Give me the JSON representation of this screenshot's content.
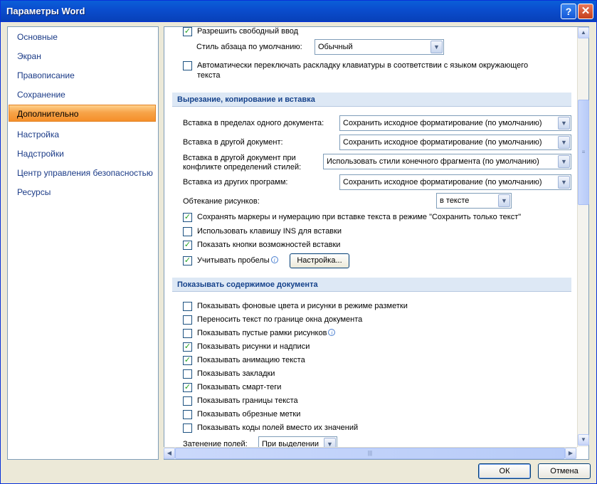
{
  "window": {
    "title": "Параметры Word",
    "help_glyph": "?",
    "close_glyph": "✕"
  },
  "sidebar": {
    "items": [
      {
        "label": "Основные"
      },
      {
        "label": "Экран"
      },
      {
        "label": "Правописание"
      },
      {
        "label": "Сохранение"
      },
      {
        "label": "Дополнительно",
        "selected": true
      },
      {
        "label": "Настройка"
      },
      {
        "label": "Надстройки"
      },
      {
        "label": "Центр управления безопасностью"
      },
      {
        "label": "Ресурсы"
      }
    ]
  },
  "editing": {
    "free_input": {
      "label": "Разрешить свободный ввод",
      "checked": true
    },
    "default_style": {
      "label": "Стиль абзаца по умолчанию:",
      "value": "Обычный"
    },
    "auto_keyboard": {
      "line1": "Автоматически переключать раскладку клавиатуры в соответствии с языком окружающего",
      "line2": "текста",
      "checked": false
    }
  },
  "cut_copy_paste": {
    "header": "Вырезание, копирование и вставка",
    "paste_same_doc": {
      "label": "Вставка в пределах одного документа:",
      "value": "Сохранить исходное форматирование (по умолчанию)"
    },
    "paste_other_doc": {
      "label": "Вставка в другой документ:",
      "value": "Сохранить исходное форматирование (по умолчанию)"
    },
    "paste_conflict": {
      "line1": "Вставка в другой документ при",
      "line2": "конфликте определений стилей:",
      "value": "Использовать стили конечного фрагмента (по умолчанию)"
    },
    "paste_other_programs": {
      "label": "Вставка из других программ:",
      "value": "Сохранить исходное форматирование (по умолчанию)"
    },
    "wrap_pictures": {
      "label": "Обтекание рисунков:",
      "value": "в тексте"
    },
    "keep_bullets": {
      "label": "Сохранять маркеры и нумерацию при вставке текста в режиме \"Сохранить только текст\"",
      "checked": true
    },
    "use_ins": {
      "label": "Использовать клавишу INS для вставки",
      "checked": false
    },
    "show_paste_options": {
      "label": "Показать кнопки возможностей вставки",
      "checked": true
    },
    "smart_spaces": {
      "label": "Учитывать пробелы",
      "checked": true
    },
    "settings_button": "Настройка..."
  },
  "show_content": {
    "header": "Показывать содержимое документа",
    "items": [
      {
        "label": "Показывать фоновые цвета и рисунки в режиме разметки",
        "checked": false
      },
      {
        "label": "Переносить текст по границе окна документа",
        "checked": false
      },
      {
        "label": "Показывать пустые рамки рисунков",
        "checked": false,
        "info": true
      },
      {
        "label": "Показывать рисунки и надписи",
        "checked": true
      },
      {
        "label": "Показывать анимацию текста",
        "checked": true
      },
      {
        "label": "Показывать закладки",
        "checked": false
      },
      {
        "label": "Показывать смарт-теги",
        "checked": true
      },
      {
        "label": "Показывать границы текста",
        "checked": false
      },
      {
        "label": "Показывать обрезные метки",
        "checked": false
      },
      {
        "label": "Показывать коды полей вместо их значений",
        "checked": false
      }
    ],
    "field_shading": {
      "label": "Затенение полей:",
      "value": "При выделении"
    }
  },
  "icons": {
    "check": "✓",
    "dropdown": "▼",
    "info": "i",
    "scroll_up": "▲",
    "scroll_down": "▼",
    "scroll_left": "◀",
    "scroll_right": "▶",
    "grip": "≡",
    "grip_h": "|||"
  },
  "footer": {
    "ok": "ОК",
    "cancel": "Отмена"
  }
}
